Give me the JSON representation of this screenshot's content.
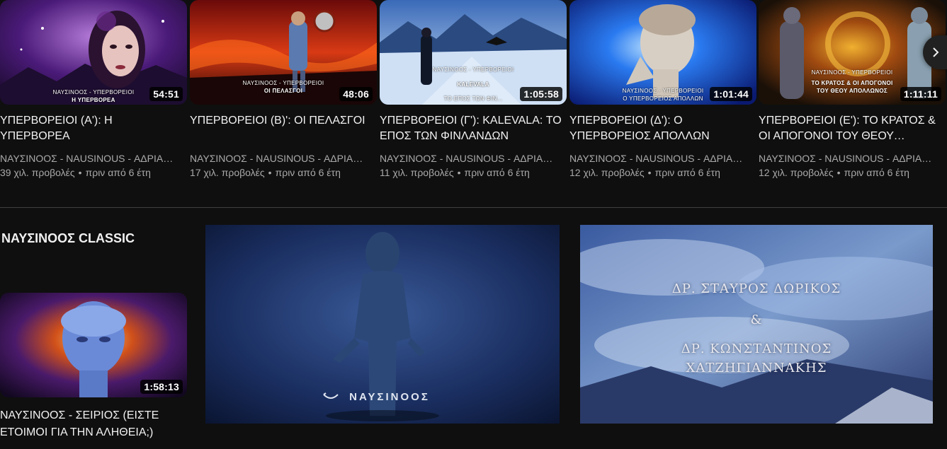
{
  "shelf": {
    "videos": [
      {
        "title": "ΥΠΕΡΒΟΡΕΙΟΙ (Α'): Η ΥΠΕΡΒΟΡΕΑ",
        "channel": "ΝΑΥΣΙΝΟΟΣ - NAUSINOUS - ΑΔΡΙΑΝΟΣ",
        "views": "39 χιλ. προβολές",
        "age": "πριν από 6 έτη",
        "duration": "54:51",
        "thumb_text": [
          "ΝΑΥΣΙΝΟΟΣ - ΥΠΕΡΒΟΡΕΙΟΙ",
          "Η ΥΠΕΡΒΟΡΕΑ"
        ]
      },
      {
        "title": "ΥΠΕΡΒΟΡΕΙΟΙ (Β)': ΟΙ ΠΕΛΑΣΓΟΙ",
        "channel": "ΝΑΥΣΙΝΟΟΣ - NAUSINOUS - ΑΔΡΙΑΝΟΣ",
        "views": "17 χιλ. προβολές",
        "age": "πριν από 6 έτη",
        "duration": "48:06",
        "thumb_text": [
          "ΝΑΥΣΙΝΟΟΣ - ΥΠΕΡΒΟΡΕΙΟΙ",
          "ΟΙ ΠΕΛΑΣΓΟΙ"
        ]
      },
      {
        "title": "ΥΠΕΡΒΟΡΕΙΟΙ (Γ'): KALEVALA: ΤΟ ΕΠΟΣ ΤΩΝ ΦΙΝΛΑΝΔΩΝ",
        "channel": "ΝΑΥΣΙΝΟΟΣ - NAUSINOUS - ΑΔΡΙΑΝΟΣ",
        "views": "11 χιλ. προβολές",
        "age": "πριν από 6 έτη",
        "duration": "1:05:58",
        "thumb_text": [
          "ΝΑΥΣΙΝΟΟΣ - ΥΠΕΡΒΟΡΕΙΟΙ",
          "KALEVALA",
          "ΤΟ ΕΠΟΣ ΤΩΝ ΦΙΝ..."
        ]
      },
      {
        "title": "ΥΠΕΡΒΟΡΕΙΟΙ (Δ'): Ο ΥΠΕΡΒΟΡΕΙΟΣ ΑΠΟΛΛΩΝ",
        "channel": "ΝΑΥΣΙΝΟΟΣ - NAUSINOUS - ΑΔΡΙΑΝΟΣ",
        "views": "12 χιλ. προβολές",
        "age": "πριν από 6 έτη",
        "duration": "1:01:44",
        "thumb_text": [
          "ΝΑΥΣΙΝΟΟΣ - ΥΠΕΡΒΟΡΕΙΟΙ",
          "Ο ΥΠΕΡΒΟΡΕΙΟΣ ΑΠΟΛΛΩΝ"
        ]
      },
      {
        "title": "ΥΠΕΡΒΟΡΕΙΟΙ (Ε'): ΤΟ ΚΡΑΤΟΣ & ΟΙ ΑΠΟΓΟΝΟΙ ΤΟΥ ΘΕΟΥ ΑΠΟΛΛΩΝΟΣ",
        "channel": "ΝΑΥΣΙΝΟΟΣ - NAUSINOUS - ΑΔΡΙΑΝΟΣ",
        "views": "12 χιλ. προβολές",
        "age": "πριν από 6 έτη",
        "duration": "1:11:11",
        "thumb_text": [
          "ΝΑΥΣΙΝΟΟΣ - ΥΠΕΡΒΟΡΕΙΟΙ",
          "ΤΟ ΚΡΑΤΟΣ & ΟΙ ΑΠΟΓΟΝΟΙ",
          "ΤΟΥ ΘΕΟΥ ΑΠΟΛΛΩΝΟΣ"
        ]
      }
    ],
    "next_icon": "chevron-right-icon"
  },
  "section": {
    "title": "ΝΑΥΣΙΝΟΟΣ CLASSIC",
    "small_video": {
      "title": "ΝΑΥΣΙΝΟΟΣ - ΣΕΙΡΙΟΣ (ΕΙΣΤΕ ΕΤΟΙΜΟΙ ΓΙΑ ΤΗΝ ΑΛΗΘΕΙΑ;)",
      "duration": "1:58:13"
    },
    "feature_left": {
      "brand": "ΝΑΥΣΙΝΟΟΣ"
    },
    "feature_right": {
      "line1": "ΔΡ. ΣΤΑΥΡΟΣ ΔΩΡΙΚΟΣ",
      "line2": "&",
      "line3": "ΔΡ. ΚΩΝΣΤΑΝΤΙΝΟΣ",
      "line4": "ΧΑΤΖΗΓΙΑΝΝΑΚΗΣ"
    }
  },
  "colors": {
    "background": "#0f0f0f",
    "text_primary": "#f1f1f1",
    "text_secondary": "#aaaaaa"
  }
}
